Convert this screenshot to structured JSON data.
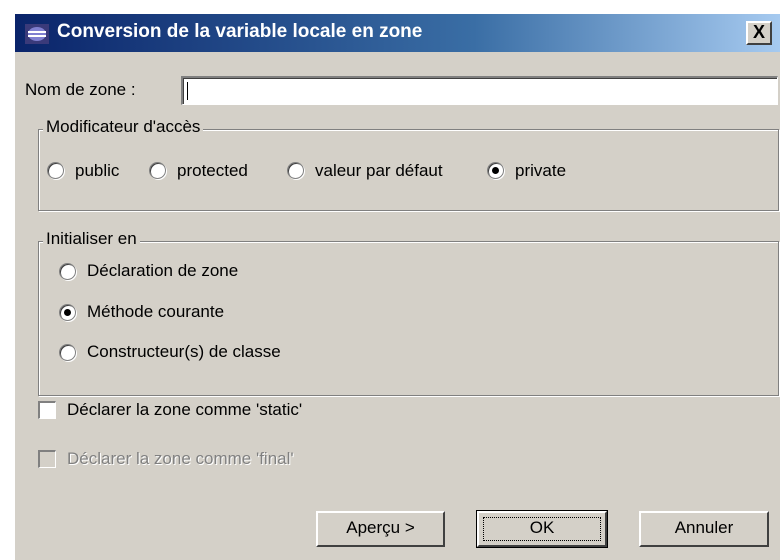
{
  "window": {
    "title": "Conversion de la variable locale en zone",
    "close_label": "X"
  },
  "field": {
    "label": "Nom de zone :",
    "value": ""
  },
  "access": {
    "label": "Modificateur d'accès",
    "options": [
      "public",
      "protected",
      "valeur par défaut",
      "private"
    ],
    "selected": "private"
  },
  "init": {
    "label": "Initialiser en",
    "options": [
      "Déclaration de zone",
      "Méthode courante",
      "Constructeur(s) de classe"
    ],
    "selected": "Méthode courante"
  },
  "checks": [
    {
      "label": "Déclarer la zone comme 'static'",
      "checked": false,
      "enabled": true
    },
    {
      "label": "Déclarer la zone comme 'final'",
      "checked": false,
      "enabled": false
    }
  ],
  "buttons": {
    "preview": "Aperçu >",
    "ok": "OK",
    "cancel": "Annuler"
  }
}
